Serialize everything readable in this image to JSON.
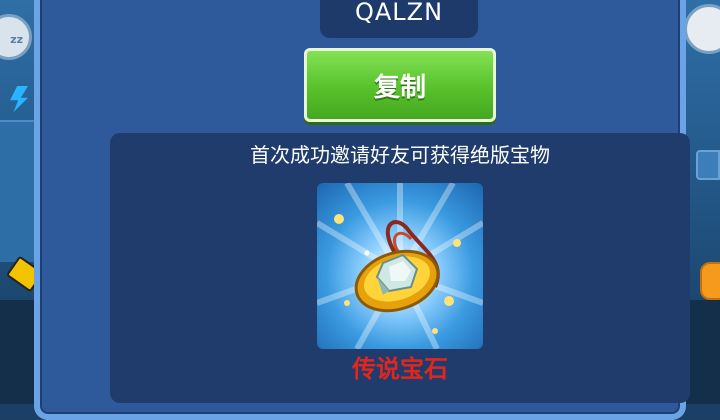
{
  "invite": {
    "code": "QALZN",
    "copy_label": "复制"
  },
  "reward": {
    "description": "首次成功邀请好友可获得绝版宝物",
    "item_name": "传说宝石",
    "item_icon": "gem-amulet-icon",
    "item_name_color": "#e3261d"
  },
  "background": {
    "left_badge_text": "zz"
  },
  "colors": {
    "dialog_bg": "#2e5a9c",
    "dialog_border": "#6aa4e6",
    "copy_button": "#58c12c"
  }
}
